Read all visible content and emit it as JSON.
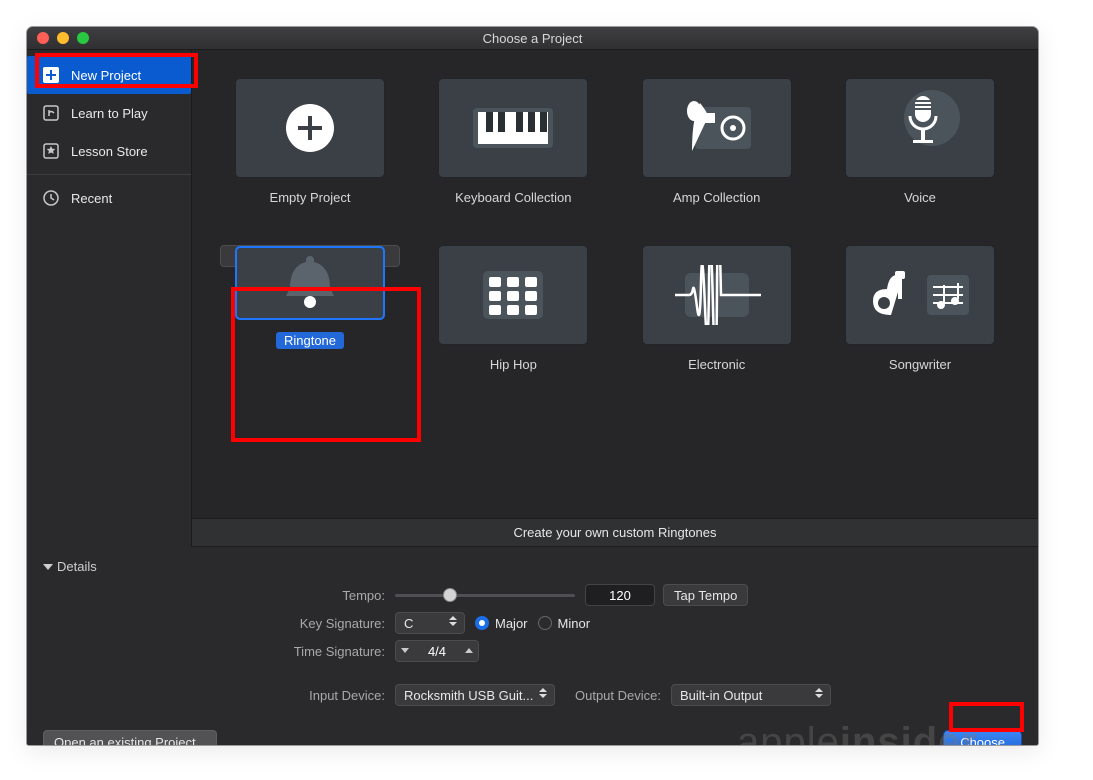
{
  "window": {
    "title": "Choose a Project"
  },
  "sidebar": {
    "items": [
      {
        "label": "New Project"
      },
      {
        "label": "Learn to Play"
      },
      {
        "label": "Lesson Store"
      },
      {
        "label": "Recent"
      }
    ]
  },
  "projects": [
    {
      "label": "Empty Project"
    },
    {
      "label": "Keyboard Collection"
    },
    {
      "label": "Amp Collection"
    },
    {
      "label": "Voice"
    },
    {
      "label": "Ringtone"
    },
    {
      "label": "Hip Hop"
    },
    {
      "label": "Electronic"
    },
    {
      "label": "Songwriter"
    }
  ],
  "hint": "Create your own custom Ringtones",
  "details": {
    "header": "Details",
    "tempo_label": "Tempo:",
    "tempo_value": "120",
    "tap_tempo": "Tap Tempo",
    "keysig_label": "Key Signature:",
    "keysig_value": "C",
    "major": "Major",
    "minor": "Minor",
    "timesig_label": "Time Signature:",
    "timesig_value": "4/4",
    "input_label": "Input Device:",
    "input_value": "Rocksmith USB Guit...",
    "output_label": "Output Device:",
    "output_value": "Built-in Output"
  },
  "buttons": {
    "open_existing": "Open an existing Project...",
    "choose": "Choose"
  },
  "watermark": {
    "a": "apple",
    "b": "insider"
  }
}
